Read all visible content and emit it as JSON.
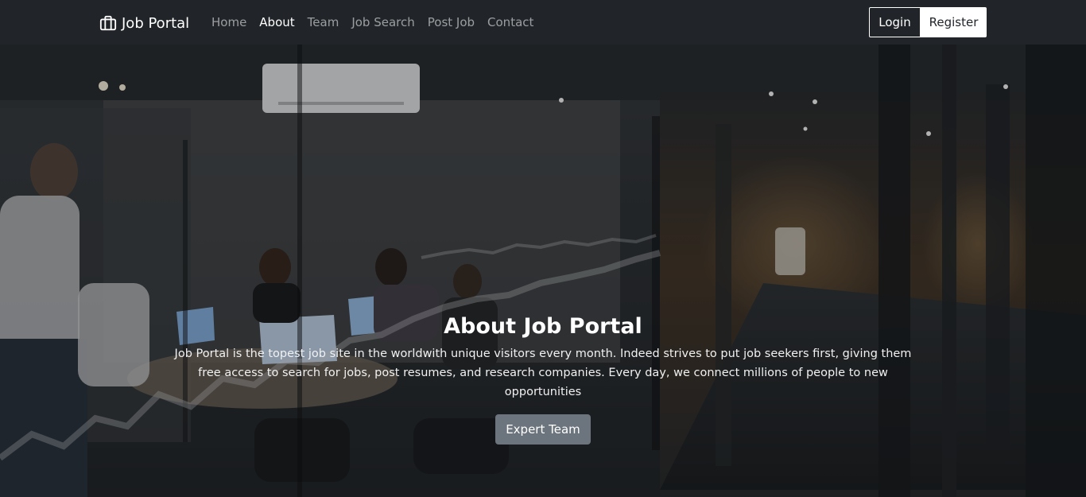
{
  "navbar": {
    "brand": "Job Portal",
    "links": [
      "Home",
      "About",
      "Team",
      "Job Search",
      "Post Job",
      "Contact"
    ],
    "login_label": "Login",
    "register_label": "Register"
  },
  "hero": {
    "title": "About Job Portal",
    "text": "Job Portal is the topest job site in the worldwith unique visitors every month. Indeed strives to put job seekers first, giving them free access to search for jobs, post resumes, and research companies. Every day, we connect millions of people to new opportunities",
    "button_label": "Expert Team"
  },
  "colors": {
    "navbar": "#212529",
    "button_secondary": "#6c757d"
  },
  "icons": {
    "brand": "briefcase-icon"
  }
}
